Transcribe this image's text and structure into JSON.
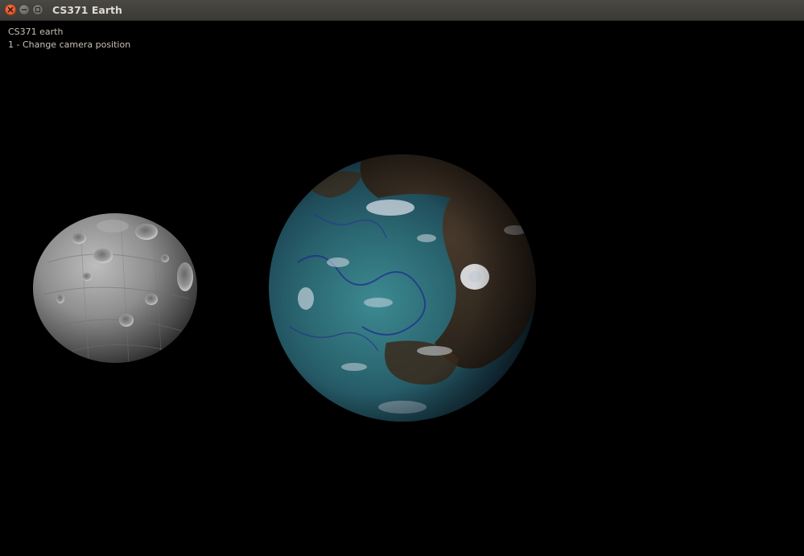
{
  "window": {
    "title": "CS371 Earth",
    "controls": {
      "close_icon": "close-icon",
      "minimize_icon": "minimize-icon",
      "maximize_icon": "maximize-icon"
    }
  },
  "hud": {
    "title": "CS371 earth",
    "instruction": "1 - Change camera position"
  },
  "scene": {
    "objects": [
      "moon",
      "earth"
    ],
    "colors": {
      "background": "#000000",
      "ocean": "#2d6a72",
      "land": "#3a2a1e",
      "clouds": "#d8dde8",
      "moon": "#9a9a9a"
    }
  }
}
